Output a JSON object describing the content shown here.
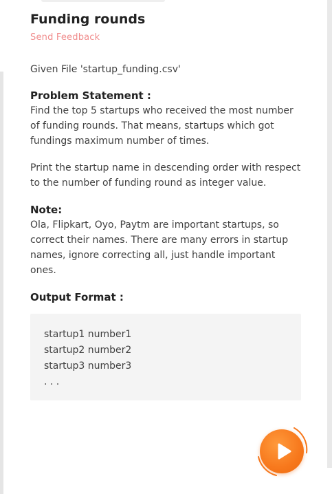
{
  "problem": {
    "title": "Funding rounds",
    "feedback_label": "Send Feedback",
    "given_file": "Given File 'startup_funding.csv'",
    "problem_statement_heading": "Problem Statement :",
    "problem_statement_text": "Find the top 5 startups who received the most number of funding rounds. That means, startups which got fundings maximum number of times.",
    "print_text": "Print the startup name in descending order with respect to the number of funding round as integer value.",
    "note_heading": "Note:",
    "note_text": "Ola, Flipkart, Oyo, Paytm are important startups, so correct their names. There are many errors in startup names, ignore correcting all, just handle important ones.",
    "output_format_heading": "Output Format :",
    "output_format_lines": [
      "startup1 number1",
      "startup2 number2",
      "startup3 number3",
      ". . ."
    ]
  },
  "run_button": {
    "icon": "play-icon",
    "color": "#f7781c"
  }
}
